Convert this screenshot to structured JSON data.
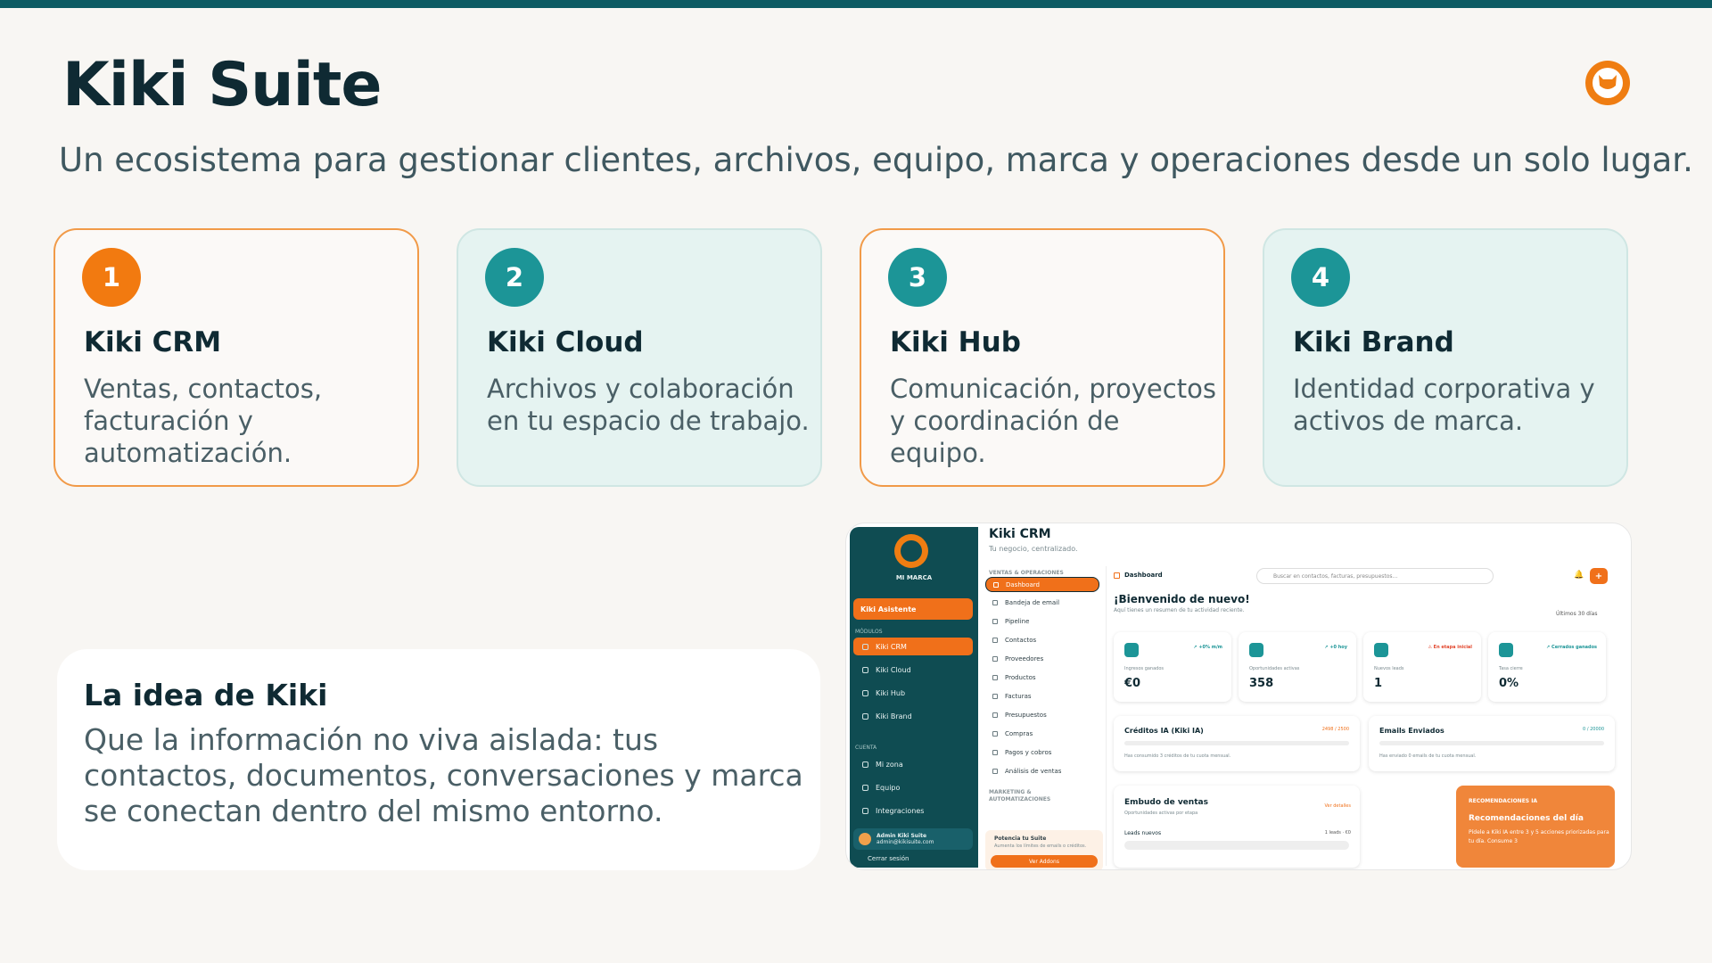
{
  "slide": {
    "title": "Kiki Suite",
    "subtitle": "Un ecosistema para gestionar clientes, archivos, equipo, marca y operaciones desde un solo lugar."
  },
  "colors": {
    "accent": "#f27a10",
    "teal": "#1c9597",
    "dark_teal": "#0d5b63",
    "text": "#0f2a33"
  },
  "cards": [
    {
      "num": "1",
      "title": "Kiki CRM",
      "desc": "Ventas, contactos, facturación y automatización.",
      "style": "orange"
    },
    {
      "num": "2",
      "title": "Kiki Cloud",
      "desc": "Archivos y colaboración en tu espacio de trabajo.",
      "style": "teal"
    },
    {
      "num": "3",
      "title": "Kiki Hub",
      "desc": "Comunicación, proyectos y coordinación de equipo.",
      "style": "orange"
    },
    {
      "num": "4",
      "title": "Kiki Brand",
      "desc": "Identidad corporativa y activos de marca.",
      "style": "teal"
    }
  ],
  "idea": {
    "heading": "La idea de Kiki",
    "body": "Que la información no viva aislada: tus contactos, documentos, conversaciones y marca se conectan dentro del mismo entorno."
  },
  "app": {
    "sidebar": {
      "brand": "MI MARCA",
      "assistant": "Kiki Asistente",
      "modules_label": "MÓDULOS",
      "modules": [
        "Kiki CRM",
        "Kiki Cloud",
        "Kiki Hub",
        "Kiki Brand"
      ],
      "account_label": "CUENTA",
      "account": [
        "Mi zona",
        "Equipo",
        "Integraciones"
      ],
      "user_name": "Admin Kiki Suite",
      "user_email": "admin@kikisuite.com",
      "logout": "Cerrar sesión"
    },
    "page_title": "Kiki CRM",
    "page_subtitle": "Tu negocio, centralizado.",
    "nav": {
      "section1": "VENTAS & OPERACIONES",
      "items": [
        "Dashboard",
        "Bandeja de email",
        "Pipeline",
        "Contactos",
        "Proveedores",
        "Productos",
        "Facturas",
        "Presupuestos",
        "Compras",
        "Pagos y cobros",
        "Análisis de ventas"
      ],
      "section2": "MARKETING & AUTOMATIZACIONES",
      "promo_title": "Potencia tu Suite",
      "promo_sub": "Aumenta los límites de emails o créditos.",
      "promo_button": "Ver Addons"
    },
    "header": {
      "crumb": "Dashboard",
      "search_placeholder": "Buscar en contactos, facturas, presupuestos...",
      "bell": "🔔",
      "plus": "+"
    },
    "welcome": "¡Bienvenido de nuevo!",
    "welcome_sub": "Aquí tienes un resumen de tu actividad reciente.",
    "range": "Últimos 30 días",
    "stats": [
      {
        "delta": "↗ +0% m/m",
        "label": "Ingresos ganados",
        "value": "€0",
        "red": false
      },
      {
        "delta": "↗ +0 hoy",
        "label": "Oportunidades activas",
        "value": "358",
        "red": false
      },
      {
        "delta": "⚠ En etapa inicial",
        "label": "Nuevos leads",
        "value": "1",
        "red": true
      },
      {
        "delta": "↗ Cerrados ganados",
        "label": "Tasa cierre",
        "value": "0%",
        "red": false
      }
    ],
    "credits": {
      "title": "Créditos IA (Kiki IA)",
      "count": "2498 / 2500",
      "sub": "Has consumido 3 créditos de tu cuota mensual."
    },
    "emails": {
      "title": "Emails Enviados",
      "count": "0 / 20000",
      "sub": "Has enviado 0 emails de tu cuota mensual."
    },
    "funnel": {
      "title": "Embudo de ventas",
      "sub": "Oportunidades activas por etapa",
      "link": "Ver detalles",
      "row_label": "Leads nuevos",
      "row_value": "1 leads · €0"
    },
    "reco": {
      "header": "RECOMENDACIONES IA",
      "title": "Recomendaciones del día",
      "body": "Pídele a Kiki IA entre 3 y 5 acciones priorizadas para tu día. Consume 3"
    }
  }
}
